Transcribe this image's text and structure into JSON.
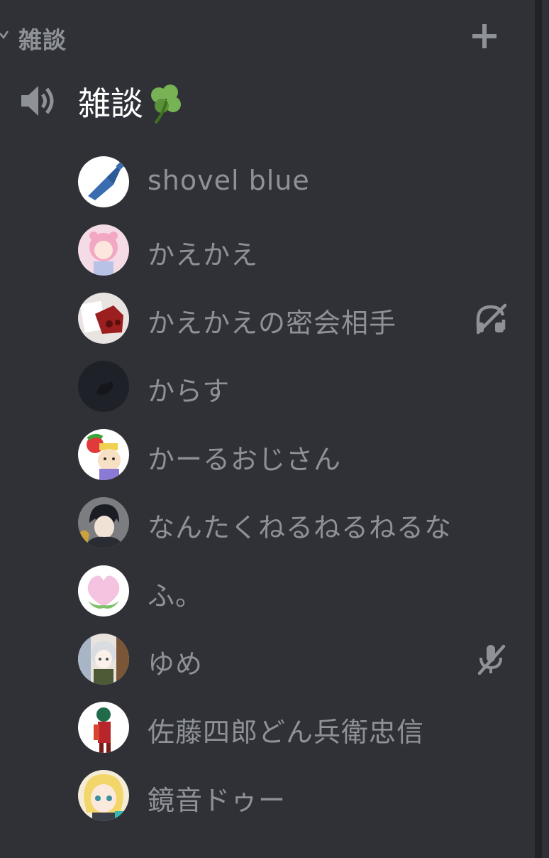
{
  "category": {
    "label": "雑談",
    "collapse_icon": "chevron-down-icon",
    "add_icon": "plus-icon"
  },
  "channel": {
    "name": "雑談",
    "emoji": "shamrock",
    "icon": "speaker-icon"
  },
  "users": [
    {
      "name": "shovel blue",
      "avatar_bg": "#ffffff",
      "status": ""
    },
    {
      "name": "かえかえ",
      "avatar_bg": "#f4dbe6",
      "status": ""
    },
    {
      "name": "かえかえの密会相手",
      "avatar_bg": "#e9e4e2",
      "status": "deafened-icon"
    },
    {
      "name": "からす",
      "avatar_bg": "#1e2128",
      "status": ""
    },
    {
      "name": "かーるおじさん",
      "avatar_bg": "#ffffff",
      "status": ""
    },
    {
      "name": "なんたくねるねるねるな",
      "avatar_bg": "#5d6068",
      "status": ""
    },
    {
      "name": "ふ。",
      "avatar_bg": "#ffffff",
      "status": ""
    },
    {
      "name": "ゆめ",
      "avatar_bg": "#e8e4dd",
      "status": "muted-icon"
    },
    {
      "name": "佐藤四郎どん兵衛忠信",
      "avatar_bg": "#ffffff",
      "status": ""
    },
    {
      "name": "鏡音ドゥー",
      "avatar_bg": "#f5ecd8",
      "status": ""
    }
  ],
  "colors": {
    "background": "#2f3136",
    "text_muted": "#8e9297",
    "text_active": "#ffffff"
  }
}
